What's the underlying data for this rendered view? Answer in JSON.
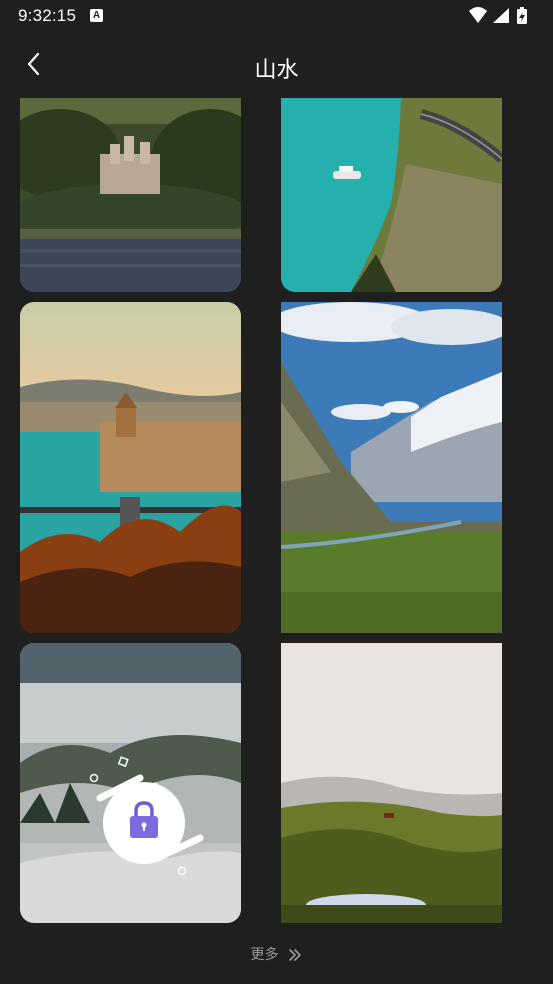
{
  "status_bar": {
    "time": "9:32:15",
    "notification_icon": "A",
    "icons": [
      "wifi-icon",
      "cellular-icon",
      "battery-charging-icon"
    ]
  },
  "header": {
    "back_icon": "chevron-left-icon",
    "title": "山水"
  },
  "wallpapers": [
    {
      "name": "castle-lake",
      "locked": false
    },
    {
      "name": "coastal-road-turquoise-bay",
      "locked": false
    },
    {
      "name": "autumn-city-river",
      "locked": false
    },
    {
      "name": "snowy-mountain-valley",
      "locked": false
    },
    {
      "name": "misty-forest-hills",
      "locked": true,
      "lock_icon": "padlock-icon"
    },
    {
      "name": "green-hills-pond",
      "locked": false
    }
  ],
  "footer": {
    "more_label": "更多",
    "more_icon": "double-chevron-right-icon"
  },
  "colors": {
    "background": "#1f1f1f",
    "lock_badge": "#ffffff",
    "lock_icon": "#6b5fd6"
  }
}
